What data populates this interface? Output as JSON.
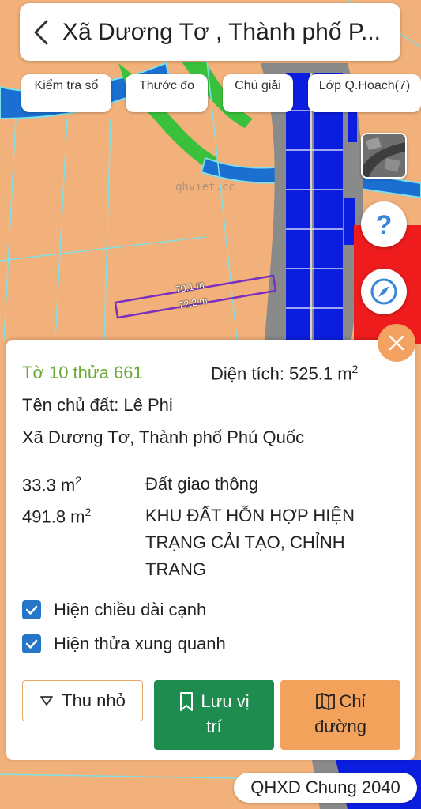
{
  "header": {
    "title": "Xã Dương Tơ , Thành phố P..."
  },
  "toolbar": {
    "kiem_tra_so": "Kiểm tra sổ",
    "thuoc_do": "Thước đo",
    "chu_giai": "Chú giải",
    "lop": "Lớp Q.Hoach(7)"
  },
  "map": {
    "watermark": "qhviet.cc",
    "edge_length_top": "70.1 m",
    "edge_length_bottom": "72.2 m",
    "colors": {
      "land_orange": "#f2b07a",
      "river_blue": "#1a6fd1",
      "green_belt": "#39c13b",
      "road_blue": "#0b1ee0",
      "red_zone": "#ee1c1c",
      "parcel_outline": "#7b2fbf",
      "boundary_cyan": "#7fe0e8"
    }
  },
  "side_buttons": {
    "help_icon": "question-icon",
    "compass_icon": "compass-icon",
    "layer_icon": "satellite-thumbnail"
  },
  "parcel": {
    "sheet_parcel": "Tờ 10 thửa 661",
    "area_label": "Diện tích: 525.1 m",
    "area_sup": "2",
    "owner": "Tên chủ đất: Lê Phi",
    "address": "Xã Dương Tơ, Thành phố Phú Quốc",
    "zones": [
      {
        "area": "33.3 m",
        "sup": "2",
        "line1": "Đất giao thông",
        "line2": "",
        "line3": ""
      },
      {
        "area": "491.8 m",
        "sup": "2",
        "line1": "KHU ĐẤT HỖN HỢP HIỆN",
        "line2": "TRẠNG CẢI TẠO, CHỈNH",
        "line3": "TRANG"
      }
    ]
  },
  "options": {
    "show_edge_lengths": "Hiện chiều dài cạnh",
    "show_neighbors": "Hiện thửa xung quanh"
  },
  "actions": {
    "collapse": "Thu nhỏ",
    "save_line1": "Lưu vị",
    "save_line2": "trí",
    "directions_line1": "Chỉ",
    "directions_line2": "đường"
  },
  "footer": {
    "plan_badge": "QHXD Chung 2040"
  }
}
